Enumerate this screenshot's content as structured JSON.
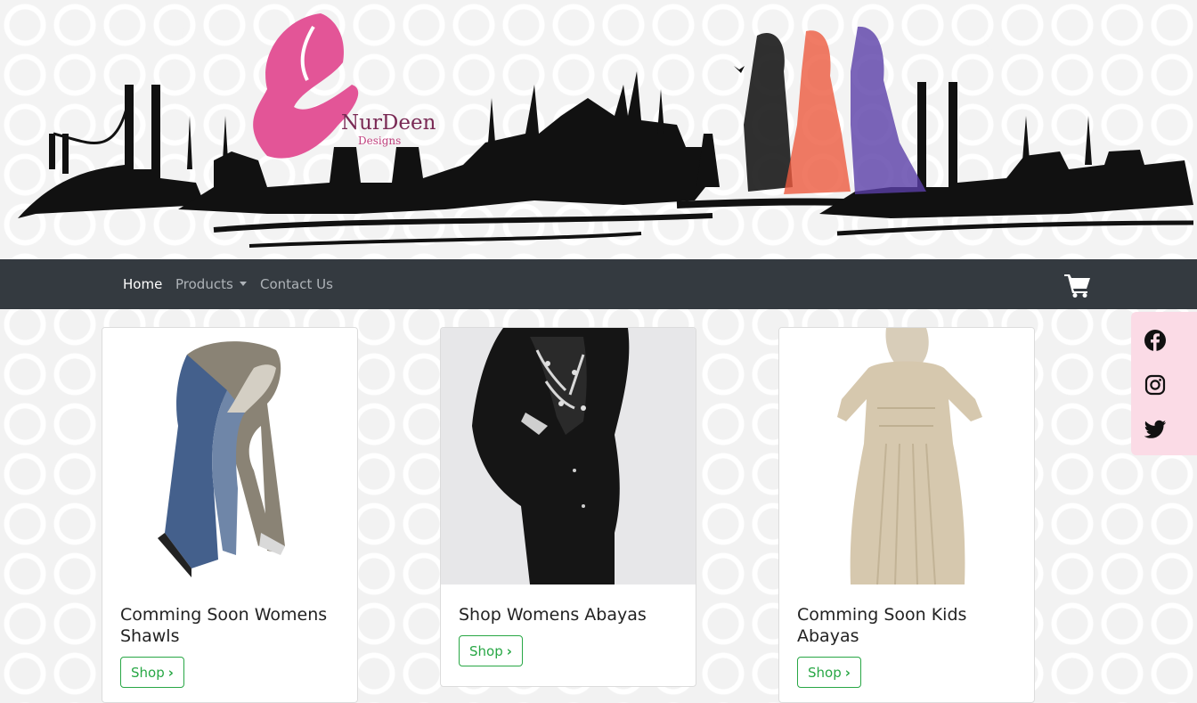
{
  "brand": {
    "name": "NurDeen",
    "tagline": "Designs"
  },
  "nav": {
    "items": [
      {
        "label": "Home"
      },
      {
        "label": "Products"
      },
      {
        "label": "Contact Us"
      }
    ]
  },
  "social": [
    "facebook-icon",
    "instagram-icon",
    "twitter-icon"
  ],
  "cards": [
    {
      "title": "Comming Soon Womens Shawls",
      "button": "Shop",
      "chevron": "›"
    },
    {
      "title": "Shop Womens Abayas",
      "button": "Shop",
      "chevron": "›"
    },
    {
      "title": "Comming Soon Kids Abayas",
      "button": "Shop",
      "chevron": "›"
    }
  ],
  "colors": {
    "navbar": "#343a40",
    "accent_green": "#28a745",
    "social_bg": "#fbdbe6",
    "logo_pink": "#e35597"
  }
}
